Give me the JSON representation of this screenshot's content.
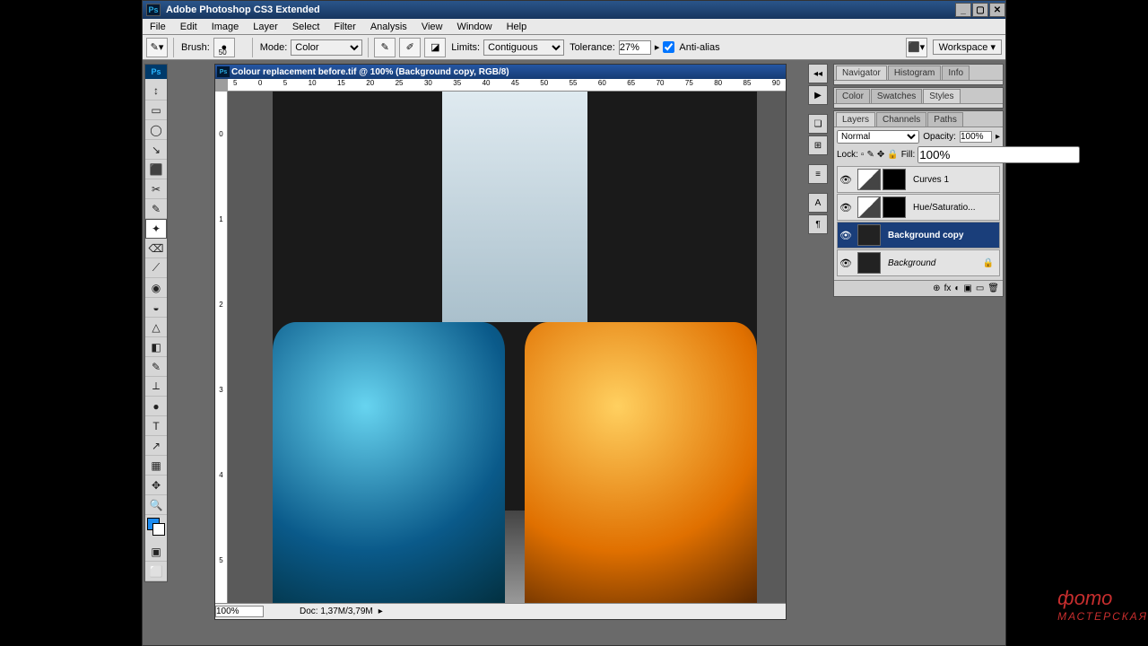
{
  "app": {
    "title": "Adobe Photoshop CS3 Extended",
    "ps_icon": "Ps"
  },
  "menu": [
    "File",
    "Edit",
    "Image",
    "Layer",
    "Select",
    "Filter",
    "Analysis",
    "View",
    "Window",
    "Help"
  ],
  "options": {
    "brush_label": "Brush:",
    "brush_size": "50",
    "mode_label": "Mode:",
    "mode_value": "Color",
    "limits_label": "Limits:",
    "limits_value": "Contiguous",
    "tolerance_label": "Tolerance:",
    "tolerance_value": "27%",
    "antialias": "Anti-alias",
    "workspace": "Workspace ▾"
  },
  "toolbox": {
    "tools_a": [
      "↕",
      "▭",
      "◯",
      "↘",
      "⬛",
      "✂",
      "✎",
      "✦",
      "⌫",
      "⟋",
      "◉",
      "◒",
      "△",
      "◧",
      "✎",
      "⬤",
      "⟂",
      "●",
      "T",
      "↗",
      "▦",
      "✥",
      "✋",
      "◐",
      "🔍"
    ],
    "fg_color": "#1d8cf0",
    "bg_color": "#ffffff",
    "mode_icons": [
      "▣",
      "⬜"
    ]
  },
  "document": {
    "title": "Colour replacement before.tif @ 100% (Background copy, RGB/8)",
    "ruler_h": [
      "5",
      "0",
      "5",
      "10",
      "15",
      "20",
      "25",
      "30",
      "35",
      "40",
      "45",
      "50",
      "55",
      "60",
      "65",
      "70",
      "75",
      "80",
      "85",
      "90"
    ],
    "ruler_v": [
      "0",
      "1",
      "2",
      "3",
      "4",
      "5"
    ],
    "zoom": "100%",
    "doc_info": "Doc: 1,37M/3,79M"
  },
  "dock_icons": [
    "◆",
    "▶",
    "❏",
    "⊞",
    "≡",
    "¶",
    "A",
    "§"
  ],
  "panels": {
    "nav": {
      "tabs": [
        "Navigator",
        "Histogram",
        "Info"
      ],
      "active": 0
    },
    "color": {
      "tabs": [
        "Color",
        "Swatches",
        "Styles"
      ],
      "active": 2
    },
    "layers": {
      "tabs": [
        "Layers",
        "Channels",
        "Paths"
      ],
      "active": 0,
      "blend_mode": "Normal",
      "opacity_label": "Opacity:",
      "opacity": "100%",
      "lock_label": "Lock:",
      "fill_label": "Fill:",
      "fill": "100%",
      "items": [
        {
          "name": "Curves 1",
          "adjustment": true,
          "mask": true,
          "visible": true
        },
        {
          "name": "Hue/Saturatio...",
          "adjustment": true,
          "mask": true,
          "visible": true
        },
        {
          "name": "Background copy",
          "adjustment": false,
          "selected": true,
          "visible": true
        },
        {
          "name": "Background",
          "adjustment": false,
          "locked": true,
          "italic": true,
          "visible": true
        }
      ],
      "foot_icons": [
        "⊕",
        "fx",
        "◐",
        "▣",
        "▭",
        "🗑"
      ]
    }
  },
  "watermark": {
    "line1": "фото",
    "line2": "МАСТЕРСКАЯ"
  }
}
